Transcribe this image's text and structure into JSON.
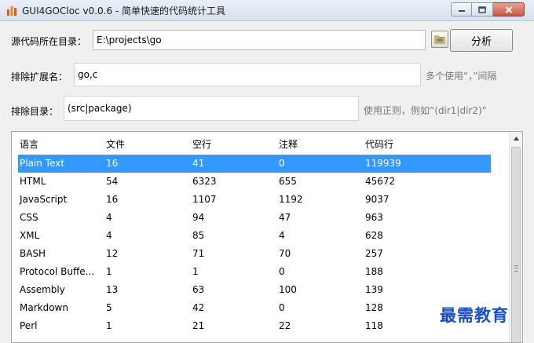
{
  "window": {
    "title": "GUI4GOCloc v0.0.6 - 简单快速的代码统计工具",
    "icon": "bar-chart-icon",
    "controls": [
      "minimize-icon",
      "maximize-icon",
      "close-icon"
    ]
  },
  "form": {
    "source_dir_label": "源代码所在目录：",
    "source_dir_value": "E:\\projects\\go",
    "analyze_label": "分析",
    "exclude_ext_label": "排除扩展名：",
    "exclude_ext_value": "go,c",
    "exclude_ext_hint": "多个使用“，”间隔",
    "exclude_dir_label": "排除目录：",
    "exclude_dir_value": "(src|package)",
    "exclude_dir_hint": "使用正则，例如“(dir1|dir2)”"
  },
  "table": {
    "columns": [
      "语言",
      "文件",
      "空行",
      "注释",
      "代码行"
    ],
    "selected_row": 0,
    "rows": [
      [
        "Plain Text",
        "16",
        "41",
        "0",
        "119939"
      ],
      [
        "HTML",
        "54",
        "6323",
        "655",
        "45672"
      ],
      [
        "JavaScript",
        "16",
        "1107",
        "1192",
        "9037"
      ],
      [
        "CSS",
        "4",
        "94",
        "47",
        "963"
      ],
      [
        "XML",
        "4",
        "85",
        "4",
        "628"
      ],
      [
        "BASH",
        "12",
        "71",
        "70",
        "257"
      ],
      [
        "Protocol Buffe...",
        "1",
        "1",
        "0",
        "188"
      ],
      [
        "Assembly",
        "13",
        "63",
        "100",
        "139"
      ],
      [
        "Markdown",
        "5",
        "42",
        "0",
        "128"
      ],
      [
        "Perl",
        "1",
        "21",
        "22",
        "118"
      ]
    ]
  },
  "watermark": "最需教育",
  "colors": {
    "selection": "#3399ff",
    "watermark": "#1a4fc2",
    "close_button": "#c85a43"
  }
}
